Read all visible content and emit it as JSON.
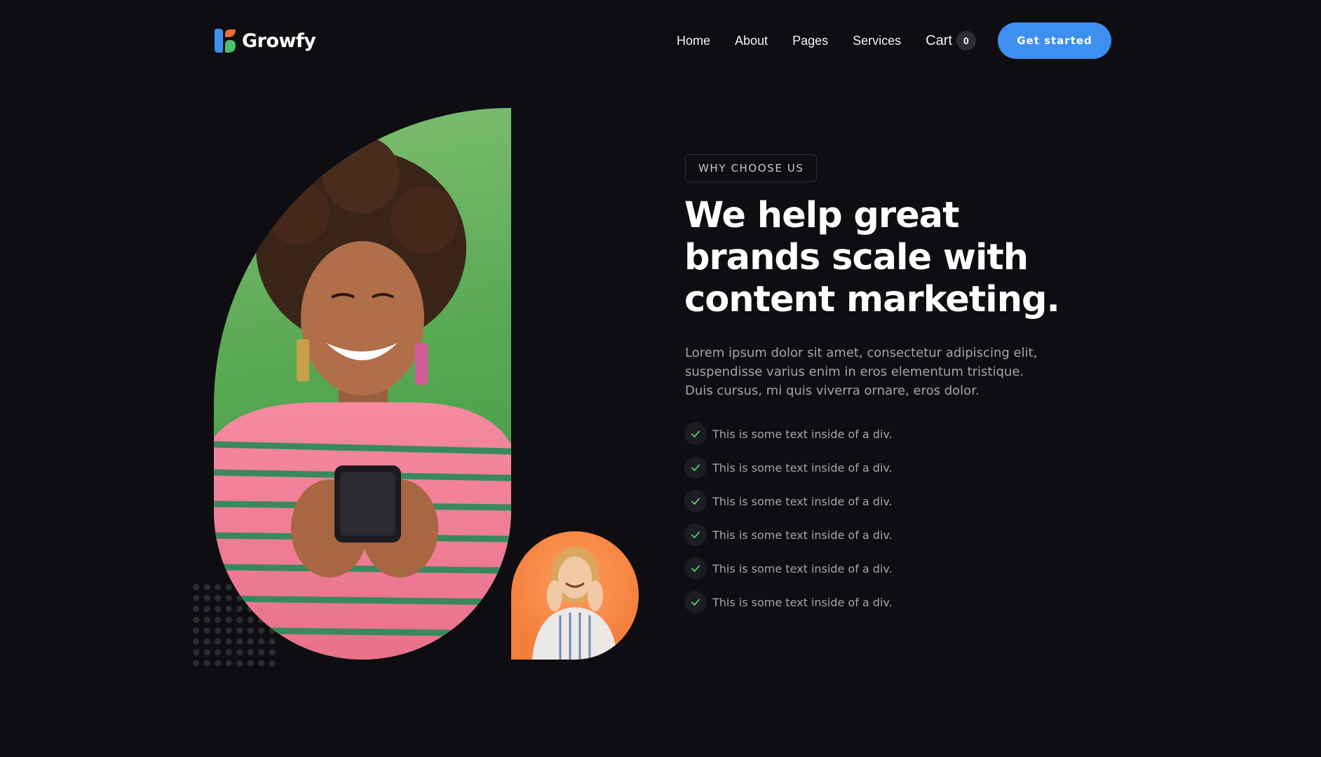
{
  "brand": {
    "name": "Growfy",
    "logo_icon": "leaf-mark-icon",
    "logo_colors": [
      "#3d8ff0",
      "#f36b3a",
      "#4cc26a"
    ]
  },
  "nav": {
    "links": [
      "Home",
      "About",
      "Pages",
      "Services"
    ],
    "cart_label": "Cart",
    "cart_count": "0",
    "cta_label": "Get started"
  },
  "hero": {
    "tag": "WHY CHOOSE US",
    "heading": "We help great brands scale with content marketing.",
    "paragraph": "Lorem ipsum dolor sit amet, consectetur adipiscing elit, suspendisse varius enim in eros elementum tristique. Duis cursus, mi quis viverra ornare, eros dolor.",
    "checklist": [
      "This is some text inside of a div.",
      "This is some text inside of a div.",
      "This is some text inside of a div.",
      "This is some text inside of a div.",
      "This is some text inside of a div.",
      "This is some text inside of a div."
    ],
    "check_icon": "check-icon",
    "check_color": "#4cc26a"
  },
  "images": {
    "main": "woman-with-phone-photo",
    "main_background": "#5aad57",
    "small": "smiling-woman-photo",
    "small_background": "#f4823e"
  },
  "colors": {
    "background": "#0d0d12",
    "accent": "#3d8ff0"
  }
}
